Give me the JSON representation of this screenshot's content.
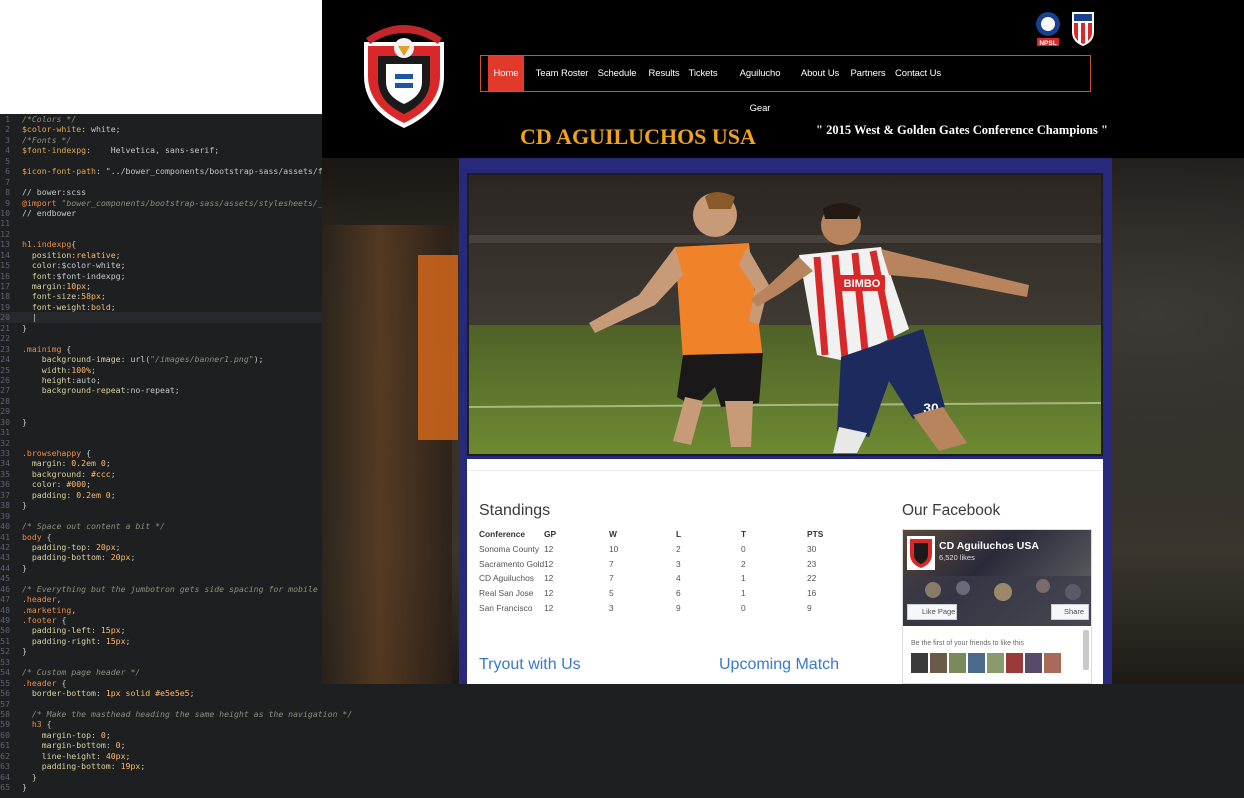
{
  "editor": {
    "lines": [
      {
        "n": "1",
        "parts": [
          [
            "cmt",
            "/*Colors */"
          ]
        ]
      },
      {
        "n": "2",
        "parts": [
          [
            "kw",
            "$color-white"
          ],
          [
            "",
            ": white;"
          ]
        ]
      },
      {
        "n": "3",
        "parts": [
          [
            "cmt",
            "/*Fonts */"
          ]
        ]
      },
      {
        "n": "4",
        "parts": [
          [
            "kw",
            "$font-indexpg"
          ],
          [
            "",
            ":    Helvetica, sans-serif;"
          ]
        ]
      },
      {
        "n": "5",
        "parts": []
      },
      {
        "n": "6",
        "parts": [
          [
            "kw",
            "$icon-font-path"
          ],
          [
            "",
            ": \"../bower_components/bootstrap-sass/assets/fonts/bootstrap/\";"
          ]
        ]
      },
      {
        "n": "7",
        "parts": []
      },
      {
        "n": "8",
        "parts": [
          [
            "",
            "// bower:scss"
          ]
        ]
      },
      {
        "n": "9",
        "parts": [
          [
            "cl",
            "@import"
          ],
          [
            "cmt",
            " \"bower_components/bootstrap-sass/assets/stylesheets/_bootstrap.scss\";"
          ]
        ]
      },
      {
        "n": "10",
        "parts": [
          [
            "",
            "// endbower"
          ]
        ]
      },
      {
        "n": "11",
        "parts": []
      },
      {
        "n": "12",
        "parts": []
      },
      {
        "n": "13",
        "parts": [
          [
            "cl",
            "h1.indexpg"
          ],
          [
            "",
            "{"
          ]
        ]
      },
      {
        "n": "14",
        "parts": [
          [
            "prop",
            "  position"
          ],
          [
            "",
            ":"
          ],
          [
            "val",
            "relative"
          ],
          [
            "",
            ";"
          ]
        ]
      },
      {
        "n": "15",
        "parts": [
          [
            "prop",
            "  color"
          ],
          [
            "",
            ":$color-white;"
          ]
        ]
      },
      {
        "n": "16",
        "parts": [
          [
            "prop",
            "  font"
          ],
          [
            "",
            ":$font-indexpg;"
          ]
        ]
      },
      {
        "n": "17",
        "parts": [
          [
            "prop",
            "  margin"
          ],
          [
            "",
            ":"
          ],
          [
            "val",
            "10px"
          ],
          [
            "",
            ";"
          ]
        ]
      },
      {
        "n": "18",
        "parts": [
          [
            "prop",
            "  font-size"
          ],
          [
            "",
            ":"
          ],
          [
            "val",
            "58px"
          ],
          [
            "",
            ";"
          ]
        ]
      },
      {
        "n": "19",
        "parts": [
          [
            "prop",
            "  font-weight"
          ],
          [
            "",
            ":"
          ],
          [
            "val",
            "bold"
          ],
          [
            "",
            ";"
          ]
        ]
      },
      {
        "n": "20",
        "parts": [
          [
            "",
            "  |"
          ]
        ],
        "cur": true
      },
      {
        "n": "21",
        "parts": [
          [
            "",
            "}"
          ]
        ]
      },
      {
        "n": "22",
        "parts": []
      },
      {
        "n": "23",
        "parts": [
          [
            "cl",
            ".mainimg"
          ],
          [
            "",
            " {"
          ]
        ]
      },
      {
        "n": "24",
        "parts": [
          [
            "prop",
            "    background-image"
          ],
          [
            "",
            ": url("
          ],
          [
            "cmt",
            "\"/images/banner1.png\""
          ],
          [
            "",
            ");"
          ]
        ]
      },
      {
        "n": "25",
        "parts": [
          [
            "prop",
            "    width"
          ],
          [
            "",
            ":"
          ],
          [
            "val",
            "100%"
          ],
          [
            "",
            ";"
          ]
        ]
      },
      {
        "n": "26",
        "parts": [
          [
            "prop",
            "    height"
          ],
          [
            "",
            ":auto;"
          ]
        ]
      },
      {
        "n": "27",
        "parts": [
          [
            "prop",
            "    background-repeat"
          ],
          [
            "",
            ":no-repeat;"
          ]
        ]
      },
      {
        "n": "28",
        "parts": []
      },
      {
        "n": "29",
        "parts": []
      },
      {
        "n": "30",
        "parts": [
          [
            "",
            "}"
          ]
        ]
      },
      {
        "n": "31",
        "parts": []
      },
      {
        "n": "32",
        "parts": []
      },
      {
        "n": "33",
        "parts": [
          [
            "cl",
            ".browsehappy"
          ],
          [
            "",
            " {"
          ]
        ]
      },
      {
        "n": "34",
        "parts": [
          [
            "prop",
            "  margin"
          ],
          [
            "",
            ": "
          ],
          [
            "val",
            "0.2em 0"
          ],
          [
            "",
            ";"
          ]
        ]
      },
      {
        "n": "35",
        "parts": [
          [
            "prop",
            "  background"
          ],
          [
            "",
            ": "
          ],
          [
            "val",
            "#ccc"
          ],
          [
            "",
            ";"
          ]
        ]
      },
      {
        "n": "36",
        "parts": [
          [
            "prop",
            "  color"
          ],
          [
            "",
            ": "
          ],
          [
            "val",
            "#000"
          ],
          [
            "",
            ";"
          ]
        ]
      },
      {
        "n": "37",
        "parts": [
          [
            "prop",
            "  padding"
          ],
          [
            "",
            ": "
          ],
          [
            "val",
            "0.2em 0"
          ],
          [
            "",
            ";"
          ]
        ]
      },
      {
        "n": "38",
        "parts": [
          [
            "",
            "}"
          ]
        ]
      },
      {
        "n": "39",
        "parts": []
      },
      {
        "n": "40",
        "parts": [
          [
            "cmt",
            "/* Space out content a bit */"
          ]
        ]
      },
      {
        "n": "41",
        "parts": [
          [
            "cl",
            "body"
          ],
          [
            "",
            " {"
          ]
        ]
      },
      {
        "n": "42",
        "parts": [
          [
            "prop",
            "  padding-top"
          ],
          [
            "",
            ": "
          ],
          [
            "val",
            "20px"
          ],
          [
            "",
            ";"
          ]
        ]
      },
      {
        "n": "43",
        "parts": [
          [
            "prop",
            "  padding-bottom"
          ],
          [
            "",
            ": "
          ],
          [
            "val",
            "20px"
          ],
          [
            "",
            ";"
          ]
        ]
      },
      {
        "n": "44",
        "parts": [
          [
            "",
            "}"
          ]
        ]
      },
      {
        "n": "45",
        "parts": []
      },
      {
        "n": "46",
        "parts": [
          [
            "cmt",
            "/* Everything but the jumbotron gets side spacing for mobile first views */"
          ]
        ]
      },
      {
        "n": "47",
        "parts": [
          [
            "cl",
            ".header"
          ],
          [
            "",
            ","
          ]
        ]
      },
      {
        "n": "48",
        "parts": [
          [
            "cl",
            ".marketing"
          ],
          [
            "",
            ","
          ]
        ]
      },
      {
        "n": "49",
        "parts": [
          [
            "cl",
            ".footer"
          ],
          [
            "",
            " {"
          ]
        ]
      },
      {
        "n": "50",
        "parts": [
          [
            "prop",
            "  padding-left"
          ],
          [
            "",
            ": "
          ],
          [
            "val",
            "15px"
          ],
          [
            "",
            ";"
          ]
        ]
      },
      {
        "n": "51",
        "parts": [
          [
            "prop",
            "  padding-right"
          ],
          [
            "",
            ": "
          ],
          [
            "val",
            "15px"
          ],
          [
            "",
            ";"
          ]
        ]
      },
      {
        "n": "52",
        "parts": [
          [
            "",
            "}"
          ]
        ]
      },
      {
        "n": "53",
        "parts": []
      },
      {
        "n": "54",
        "parts": [
          [
            "cmt",
            "/* Custom page header */"
          ]
        ]
      },
      {
        "n": "55",
        "parts": [
          [
            "cl",
            ".header"
          ],
          [
            "",
            " {"
          ]
        ]
      },
      {
        "n": "56",
        "parts": [
          [
            "prop",
            "  border-bottom"
          ],
          [
            "",
            ": "
          ],
          [
            "val",
            "1px solid #e5e5e5"
          ],
          [
            "",
            ";"
          ]
        ]
      },
      {
        "n": "57",
        "parts": []
      },
      {
        "n": "58",
        "parts": [
          [
            "cmt",
            "  /* Make the masthead heading the same height as the navigation */"
          ]
        ]
      },
      {
        "n": "59",
        "parts": [
          [
            "cl",
            "  h3"
          ],
          [
            "",
            " {"
          ]
        ]
      },
      {
        "n": "60",
        "parts": [
          [
            "prop",
            "    margin-top"
          ],
          [
            "",
            ": "
          ],
          [
            "val",
            "0"
          ],
          [
            "",
            ";"
          ]
        ]
      },
      {
        "n": "61",
        "parts": [
          [
            "prop",
            "    margin-bottom"
          ],
          [
            "",
            ": "
          ],
          [
            "val",
            "0"
          ],
          [
            "",
            ";"
          ]
        ]
      },
      {
        "n": "62",
        "parts": [
          [
            "prop",
            "    line-height"
          ],
          [
            "",
            ": "
          ],
          [
            "val",
            "40px"
          ],
          [
            "",
            ";"
          ]
        ]
      },
      {
        "n": "63",
        "parts": [
          [
            "prop",
            "    padding-bottom"
          ],
          [
            "",
            ": "
          ],
          [
            "val",
            "19px"
          ],
          [
            "",
            ";"
          ]
        ]
      },
      {
        "n": "64",
        "parts": [
          [
            "",
            "  }"
          ]
        ]
      },
      {
        "n": "65",
        "parts": [
          [
            "",
            "}"
          ]
        ]
      }
    ]
  },
  "site": {
    "nav": [
      "Home",
      "Team Roster",
      "Schedule",
      "Results",
      "Tickets",
      "Aguilucho Gear",
      "About Us",
      "Partners",
      "Contact Us"
    ],
    "active_nav": "Home",
    "title": "CD AGUILUCHOS USA",
    "tagline": "\" 2015 West & Golden Gates Conference Champions \"",
    "badges": {
      "npsl": "NPSL"
    },
    "standings_title": "Standings",
    "standings_headers": [
      "Conference",
      "GP",
      "W",
      "L",
      "T",
      "PTS"
    ],
    "standings_rows": [
      [
        "Sonoma County",
        "12",
        "10",
        "2",
        "0",
        "30"
      ],
      [
        "Sacramento Gold",
        "12",
        "7",
        "3",
        "2",
        "23"
      ],
      [
        "CD Aguiluchos",
        "12",
        "7",
        "4",
        "1",
        "22"
      ],
      [
        "Real San Jose",
        "12",
        "5",
        "6",
        "1",
        "16"
      ],
      [
        "San Francisco",
        "12",
        "3",
        "9",
        "0",
        "9"
      ]
    ],
    "tryout_title": "Tryout with Us",
    "match_title": "Upcoming Match",
    "facebook": {
      "title": "Our Facebook",
      "page_name": "CD Aguiluchos USA",
      "likes": "6,520 likes",
      "like_label": "Like Page",
      "share_label": "Share",
      "friends_text": "Be the first of your friends to like this"
    },
    "hero": {
      "jersey_text": "BIMBO",
      "jersey_number": "30"
    },
    "colors": {
      "accent_nav": "#e1392a",
      "nav_border": "#c1572b",
      "title_gold": "#f0a418",
      "frame_blue": "#27297a",
      "link_blue": "#3a78c9"
    }
  }
}
